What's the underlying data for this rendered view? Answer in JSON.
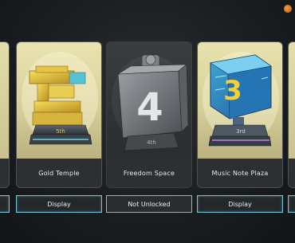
{
  "cards": [
    {
      "name": "Gold Temple",
      "rank": "5th",
      "button": "Display",
      "status": "unlocked"
    },
    {
      "name": "Freedom Space",
      "rank": "4th",
      "button": "Not Unlocked",
      "status": "locked"
    },
    {
      "name": "Music Note Plaza",
      "rank": "3rd",
      "button": "Display",
      "status": "unlocked"
    }
  ],
  "trophy_numbers": {
    "freedom": "4",
    "music": "3"
  },
  "colors": {
    "display_border": "#6ec6d6",
    "locked_border": "#a9adb0",
    "gold": "#d9b93a",
    "teal": "#3aa5c0"
  }
}
